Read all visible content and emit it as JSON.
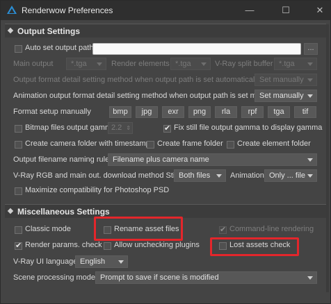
{
  "window": {
    "title": "Renderwow Preferences",
    "controls": {
      "minimize": "—",
      "maximize": "☐",
      "close": "✕"
    }
  },
  "output_settings": {
    "header": "Output Settings",
    "auto_set_output_path": {
      "label": "Auto set output path",
      "checked": false,
      "value": "",
      "browse": "..."
    },
    "main_output": {
      "label": "Main output",
      "format": "*.tga"
    },
    "render_elements": {
      "label": "Render elements",
      "format": "*.tga"
    },
    "vray_split_buffer": {
      "label": "V-Ray split buffer",
      "format": "*.tga"
    },
    "output_format_auto": {
      "label": "Output format detail setting method when output path is set automatically",
      "value": "Set manually"
    },
    "animation_output_manual": {
      "label": "Animation output format detail setting method when output path is set manual",
      "value": "Set manually"
    },
    "format_setup": {
      "label": "Format setup manually",
      "formats": [
        "bmp",
        "jpg",
        "exr",
        "png",
        "rla",
        "rpf",
        "tga",
        "tif"
      ]
    },
    "bitmap_gamma": {
      "label": "Bitmap files output gamma",
      "checked": false,
      "value": "2.2"
    },
    "fix_still_gamma": {
      "label": "Fix still file output gamma to display gamma",
      "checked": true
    },
    "create_camera_folder": {
      "label": "Create camera folder with timestamp",
      "checked": false
    },
    "create_frame_folder": {
      "label": "Create frame folder",
      "checked": false
    },
    "create_element_folder": {
      "label": "Create element folder",
      "checked": false
    },
    "naming_rule": {
      "label": "Output filename naming rule",
      "value": "Filename plus camera name"
    },
    "download_method": {
      "label": "V-Ray RGB and main out. download method Still",
      "still": "Both files",
      "animation_label": "Animation",
      "animation": "Only ... file"
    },
    "maximize_photoshop": {
      "label": "Maximize compatibility for Photoshop PSD",
      "checked": false
    }
  },
  "misc_settings": {
    "header": "Miscellaneous Settings",
    "classic_mode": {
      "label": "Classic mode",
      "checked": false
    },
    "rename_asset_files": {
      "label": "Rename asset files",
      "checked": false
    },
    "command_line_rendering": {
      "label": "Command-line rendering",
      "checked": true
    },
    "render_params_check": {
      "label": "Render params. check",
      "checked": true
    },
    "allow_unchecking_plugins": {
      "label": "Allow unchecking plugins",
      "checked": false
    },
    "lost_assets_check": {
      "label": "Lost assets check",
      "checked": false
    },
    "ui_language": {
      "label": "V-Ray UI language",
      "value": "English"
    },
    "scene_processing": {
      "label": "Scene processing modes",
      "value": "Prompt to save if scene is modified"
    }
  },
  "colors": {
    "highlight": "#e3262b",
    "background": "#444444",
    "titlebar": "#2f2f2f"
  }
}
